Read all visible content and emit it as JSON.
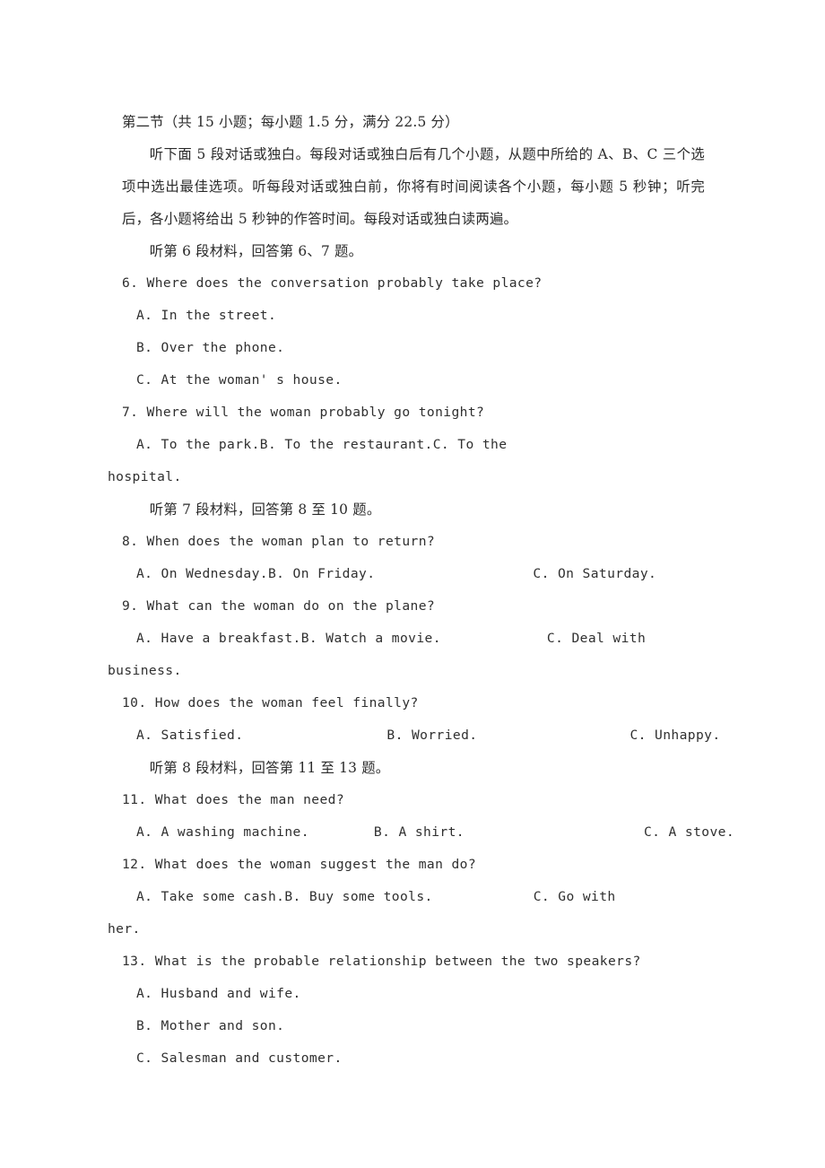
{
  "document": {
    "section_header": "第二节（共 15 小题；每小题 1.5 分，满分 22.5 分）",
    "instructions": "听下面 5 段对话或独白。每段对话或独白后有几个小题，从题中所给的 A、B、C 三个选项中选出最佳选项。听每段对话或独白前，你将有时间阅读各个小题，每小题 5 秒钟；听完后，各小题将给出 5 秒钟的作答时间。每段对话或独白读两遍。",
    "material_6": "听第 6 段材料，回答第 6、7 题。",
    "material_7": "听第 7 段材料，回答第 8 至 10 题。",
    "material_8": "听第 8 段材料，回答第 11 至 13 题。",
    "questions": {
      "q6": {
        "stem": "6. Where does the conversation probably take place?",
        "a": "A. In the street.",
        "b": "B. Over the phone.",
        "c": "C. At the woman' s house."
      },
      "q7": {
        "stem": "7. Where will the woman probably go tonight?",
        "a": "A. To the park.",
        "b": "B. To the restaurant.",
        "c_head": "C.  To  the",
        "c_tail": "hospital."
      },
      "q8": {
        "stem": "8. When does the woman plan to return?",
        "a": "A. On Wednesday.",
        "b": "B. On Friday.",
        "c": "C. On Saturday."
      },
      "q9": {
        "stem": "9. What can the woman do on the plane?",
        "a": "A. Have a breakfast.",
        "b": "B. Watch a movie.",
        "c_head": "C. Deal with",
        "c_tail": "business."
      },
      "q10": {
        "stem": "10. How does the woman feel finally?",
        "a": "A. Satisfied.",
        "b": "B. Worried.",
        "c": "C. Unhappy."
      },
      "q11": {
        "stem": "11. What does the man need?",
        "a": "A. A washing machine.",
        "b": "B. A shirt.",
        "c": "C. A stove."
      },
      "q12": {
        "stem": "12. What does the woman suggest the man do?",
        "a": "A. Take some cash.",
        "b": "B. Buy some tools.",
        "c_head": "C.  Go  with",
        "c_tail": "her."
      },
      "q13": {
        "stem": "13. What is the probable relationship between the two speakers?",
        "a": "A. Husband and wife.",
        "b": "B. Mother and son.",
        "c": "C. Salesman and customer."
      }
    }
  }
}
